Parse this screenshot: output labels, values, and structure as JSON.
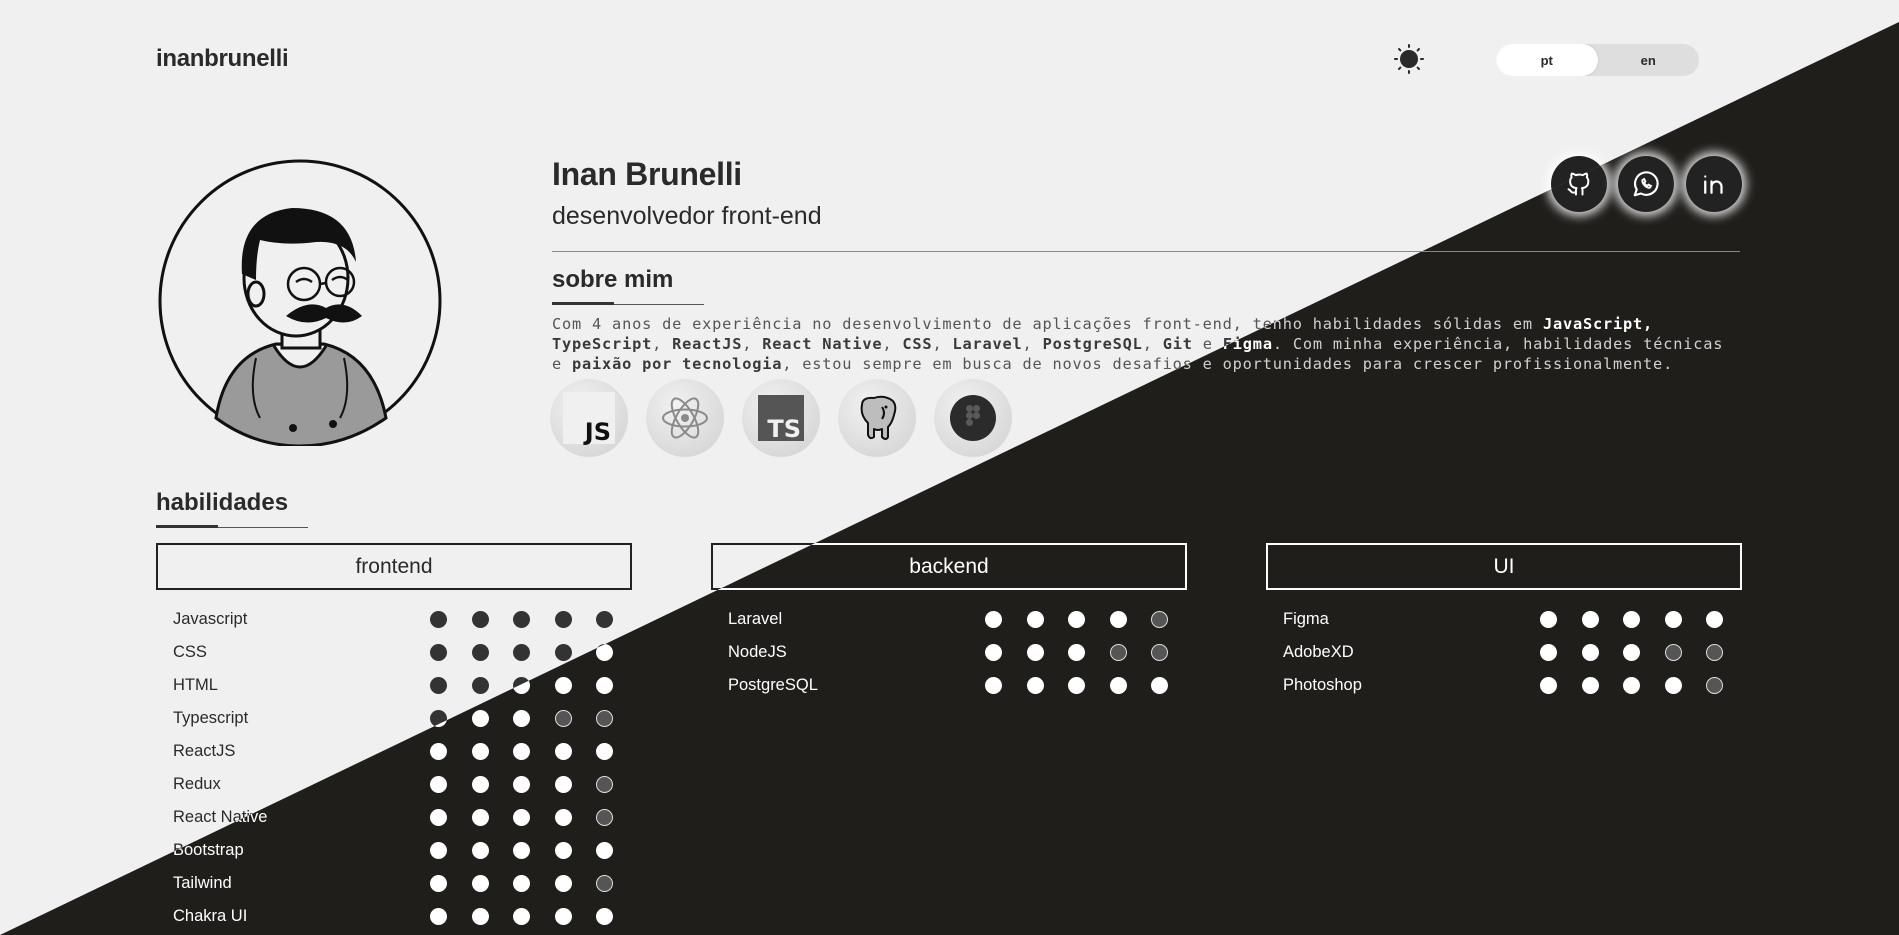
{
  "header": {
    "brand": "inanbrunelli",
    "theme_icon": "sun-icon",
    "languages": [
      {
        "label": "pt",
        "active": true
      },
      {
        "label": "en",
        "active": false
      }
    ]
  },
  "profile": {
    "name": "Inan Brunelli",
    "role": "desenvolvedor front-end",
    "avatar": "avatar-illustration",
    "social": [
      "github-icon",
      "whatsapp-icon",
      "linkedin-icon"
    ]
  },
  "about": {
    "title": "sobre mim",
    "parts": [
      {
        "t": "Com 4 anos de experiência no desenvolvimento de aplicações front-end, tenho habilidades sólidas em ",
        "b": false
      },
      {
        "t": "JavaScript, TypeScript",
        "b": true
      },
      {
        "t": ", ",
        "b": false
      },
      {
        "t": "ReactJS",
        "b": true
      },
      {
        "t": ", ",
        "b": false
      },
      {
        "t": "React Native",
        "b": true
      },
      {
        "t": ", ",
        "b": false
      },
      {
        "t": "CSS",
        "b": true
      },
      {
        "t": ", ",
        "b": false
      },
      {
        "t": "Laravel",
        "b": true
      },
      {
        "t": ", ",
        "b": false
      },
      {
        "t": "PostgreSQL",
        "b": true
      },
      {
        "t": ", ",
        "b": false
      },
      {
        "t": "Git",
        "b": true
      },
      {
        "t": " e ",
        "b": false
      },
      {
        "t": "Figma",
        "b": true
      },
      {
        "t": ". Com minha experiência, habilidades técnicas e ",
        "b": false
      },
      {
        "t": "paixão por tecnologia",
        "b": true
      },
      {
        "t": ", estou sempre em busca de novos desafios e oportunidades para crescer profissionalmente.",
        "b": false
      }
    ],
    "tech_icons": [
      {
        "icon": "javascript-icon",
        "text": "JS"
      },
      {
        "icon": "react-icon",
        "text": ""
      },
      {
        "icon": "typescript-icon",
        "text": "TS"
      },
      {
        "icon": "postgresql-icon",
        "text": ""
      },
      {
        "icon": "figma-icon",
        "text": ""
      }
    ]
  },
  "skills": {
    "title": "habilidades",
    "max_level": 5,
    "groups": [
      {
        "label": "frontend",
        "items": [
          {
            "name": "Javascript",
            "level": 5
          },
          {
            "name": "CSS",
            "level": 5
          },
          {
            "name": "HTML",
            "level": 5
          },
          {
            "name": "Typescript",
            "level": 3
          },
          {
            "name": "ReactJS",
            "level": 5
          },
          {
            "name": "Redux",
            "level": 4
          },
          {
            "name": "React Native",
            "level": 4
          },
          {
            "name": "Bootstrap",
            "level": 5
          },
          {
            "name": "Tailwind",
            "level": 4
          },
          {
            "name": "Chakra UI",
            "level": 5
          }
        ]
      },
      {
        "label": "backend",
        "items": [
          {
            "name": "Laravel",
            "level": 4
          },
          {
            "name": "NodeJS",
            "level": 3
          },
          {
            "name": "PostgreSQL",
            "level": 5
          }
        ]
      },
      {
        "label": "UI",
        "items": [
          {
            "name": "Figma",
            "level": 5
          },
          {
            "name": "AdobeXD",
            "level": 3
          },
          {
            "name": "Photoshop",
            "level": 4
          }
        ]
      }
    ]
  },
  "colors": {
    "light_bg": "#f0f0f0",
    "dark_bg": "#201e1b",
    "text_dark": "#2a2a2a",
    "text_light": "#ffffff"
  }
}
